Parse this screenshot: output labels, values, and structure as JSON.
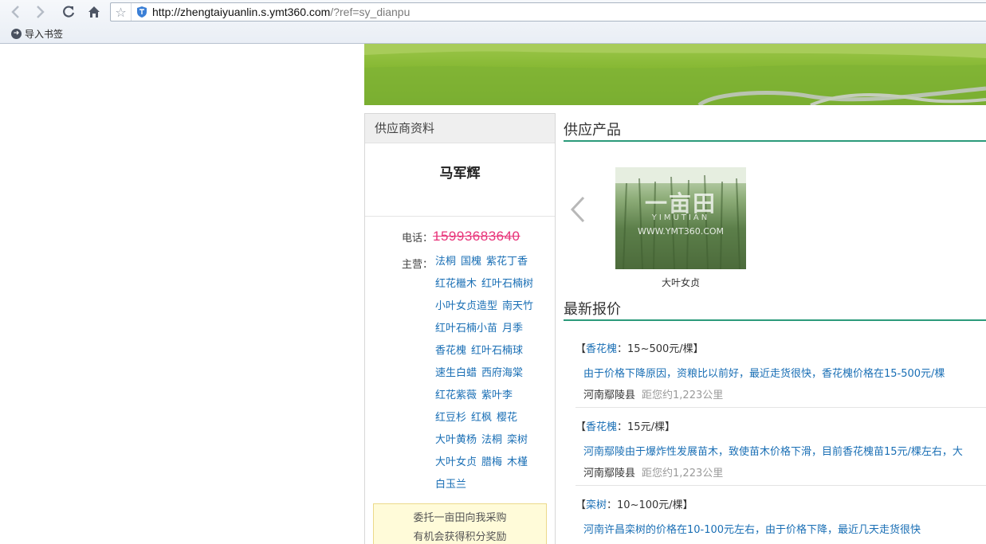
{
  "browser": {
    "url_host": "http://zhengtaiyuanlin.s.ymt360.com",
    "url_rest": "/?ref=sy_dianpu",
    "bookmark_label": "导入书签"
  },
  "supplier": {
    "panel_title": "供应商资料",
    "name": "马军辉",
    "phone_label": "电话：",
    "phone": "15993683640",
    "main_label": "主营：",
    "main_lines": [
      [
        "法桐",
        "国槐",
        "紫花丁香"
      ],
      [
        "红花檵木",
        "红叶石楠树"
      ],
      [
        "小叶女贞造型",
        "南天竹"
      ],
      [
        "红叶石楠小苗",
        "月季"
      ],
      [
        "香花槐",
        "红叶石楠球"
      ],
      [
        "速生白蜡",
        "西府海棠"
      ],
      [
        "红花紫薇",
        "紫叶李"
      ],
      [
        "红豆杉",
        "红枫",
        "樱花"
      ],
      [
        "大叶黄杨",
        "法桐",
        "栾树"
      ],
      [
        "大叶女贞",
        "腊梅",
        "木槿"
      ],
      [
        "白玉兰"
      ]
    ],
    "entrust_line1": "委托一亩田向我采购",
    "entrust_line2": "有机会获得积分奖励"
  },
  "products": {
    "title": "供应产品",
    "items": [
      {
        "name": "大叶女贞",
        "watermark": "一亩田",
        "watermark_sub": "YIMUTIAN",
        "watermark_url": "WWW.YMT360.COM"
      }
    ]
  },
  "quotes": {
    "title": "最新报价",
    "items": [
      {
        "bracket_open": "【",
        "name": "香花槐",
        "price": "：15~500元/棵",
        "bracket_close": "】",
        "desc": "由于价格下降原因，资粮比以前好，最近走货很快，香花槐价格在15-500元/棵",
        "location": "河南鄢陵县",
        "distance": "距您约1,223公里"
      },
      {
        "bracket_open": "【",
        "name": "香花槐",
        "price": "：15元/棵",
        "bracket_close": "】",
        "desc": "河南鄢陵由于爆炸性发展苗木，致使苗木价格下滑，目前香花槐苗15元/棵左右，大",
        "location": "河南鄢陵县",
        "distance": "距您约1,223公里"
      },
      {
        "bracket_open": "【",
        "name": "栾树",
        "price": "：10~100元/棵",
        "bracket_close": "】",
        "desc": "河南许昌栾树的价格在10-100元左右，由于价格下降，最近几天走货很快",
        "location": "",
        "distance": ""
      }
    ]
  },
  "colors": {
    "accent_line": "#2b9a7a",
    "link_blue": "#1a6fb5",
    "phone_pink": "#e8347a"
  }
}
